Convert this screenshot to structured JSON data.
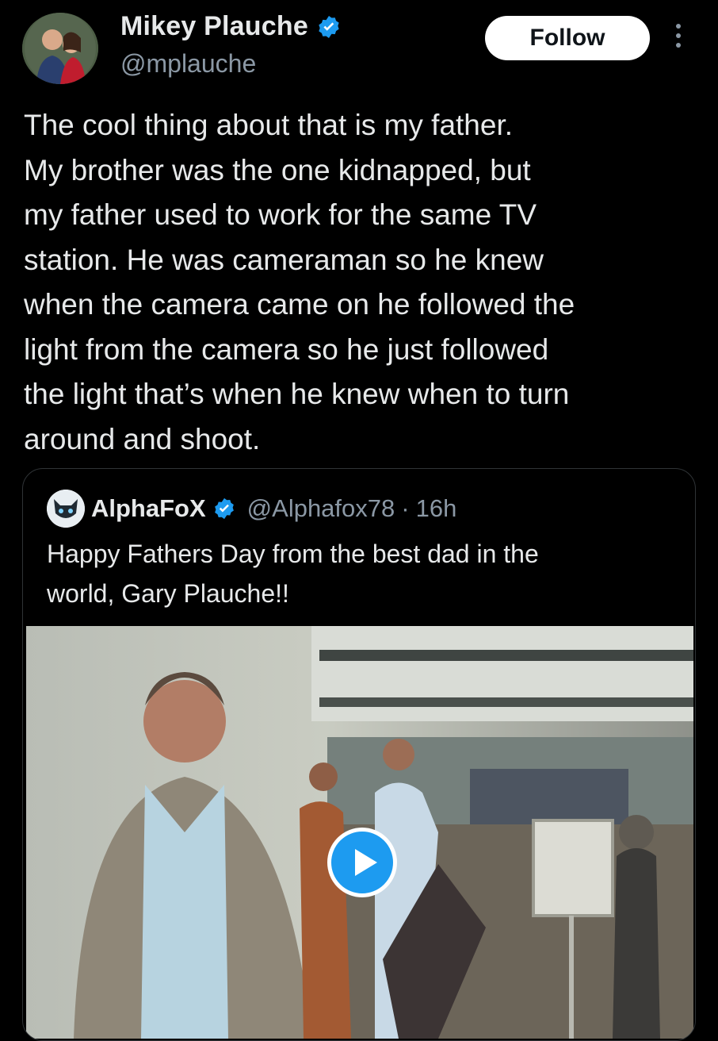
{
  "author": {
    "name": "Mikey Plauche",
    "handle": "@mplauche",
    "avatar_icon": "profile-photo"
  },
  "follow_label": "Follow",
  "post_text": "The cool thing about that is my father.\nMy brother was the one kidnapped, but\nmy father used to work for the same TV\nstation. He was cameraman so he knew\nwhen the camera came on he followed the\nlight from the camera so he just followed\nthe light that’s when he knew when to turn\naround and shoot.",
  "quoted": {
    "name": "AlphaFoX",
    "handle": "@Alphafox78",
    "time": "16h",
    "text": "Happy Fathers Day from the best dad in the\nworld, Gary Plauche!!"
  },
  "colors": {
    "background": "#000000",
    "verified": "#1d9bf0",
    "secondary_text": "#8b98a5"
  }
}
